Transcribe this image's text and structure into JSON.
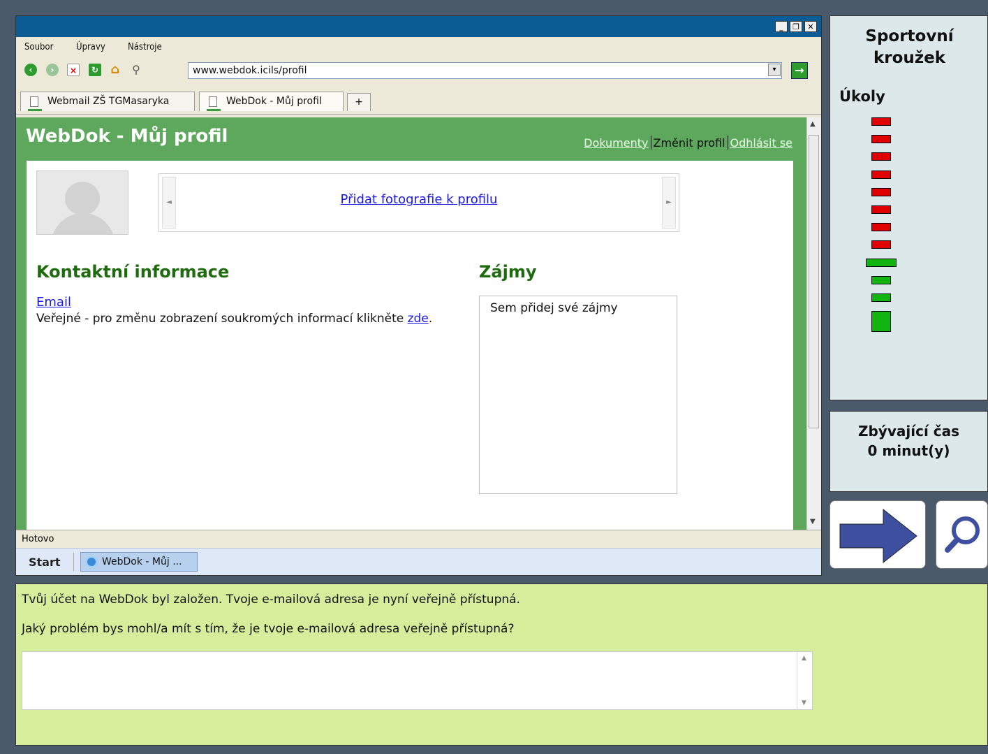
{
  "browser": {
    "menu": [
      "Soubor",
      "Úpravy",
      "Nástroje"
    ],
    "address": "www.webdok.icils/profil",
    "tabs": [
      {
        "label": "Webmail ZŠ TGMasaryka"
      },
      {
        "label": "WebDok - Můj profil"
      }
    ],
    "new_tab_label": "+",
    "status": "Hotovo",
    "taskbar": {
      "start": "Start",
      "item": "WebDok - Můj ..."
    }
  },
  "page": {
    "title": "WebDok - Můj profil",
    "nav": {
      "documents": "Dokumenty",
      "change_profile": "Změnit profil",
      "logout": "Odhlásit se"
    },
    "add_photos": "Přidat fotografie k profilu",
    "contact_heading": "Kontaktní informace",
    "email_link": "Email",
    "visibility_text": "Veřejné - pro změnu zobrazení soukromých informací klikněte ",
    "visibility_link": "zde",
    "visibility_end": ".",
    "interests_heading": "Zájmy",
    "interests_placeholder": "Sem přidej své zájmy"
  },
  "side": {
    "title_line1": "Sportovní",
    "title_line2": "kroužek",
    "tasks_label": "Úkoly",
    "tasks": [
      {
        "status": "incomplete"
      },
      {
        "status": "incomplete"
      },
      {
        "status": "incomplete"
      },
      {
        "status": "incomplete"
      },
      {
        "status": "incomplete"
      },
      {
        "status": "incomplete"
      },
      {
        "status": "incomplete"
      },
      {
        "status": "incomplete"
      },
      {
        "status": "current"
      },
      {
        "status": "complete"
      },
      {
        "status": "complete"
      },
      {
        "status": "complete-large"
      }
    ],
    "time_label": "Zbývající čas",
    "time_value": "0 minut(y)"
  },
  "question": {
    "line1": "Tvůj účet na WebDok byl založen. Tvoje e-mailová adresa je nyní veřejně přístupná.",
    "line2": "Jaký problém bys mohl/a mít s tím, že je tvoje e-mailová adresa veřejně přístupná?",
    "answer": ""
  },
  "colors": {
    "titlebar": "#0b5b94",
    "page_green": "#5ea85e",
    "task_incomplete": "#e00000",
    "task_complete": "#11b411",
    "question_bg": "#d6ee9c",
    "arrow": "#3f4fa0"
  }
}
